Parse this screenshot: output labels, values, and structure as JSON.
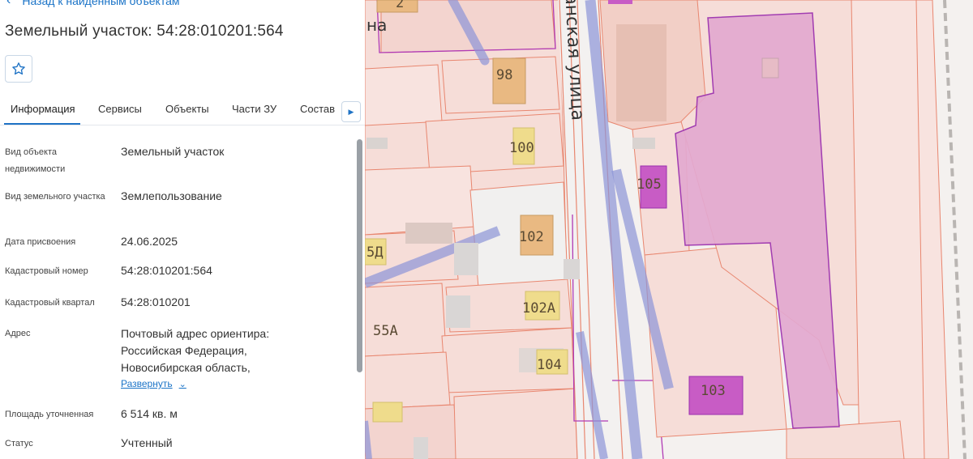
{
  "panel": {
    "back_link": "Назад к найденным объектам",
    "title": "Земельный участок: 54:28:010201:564",
    "tabs": [
      "Информация",
      "Сервисы",
      "Объекты",
      "Части ЗУ",
      "Состав"
    ],
    "active_tab": "Информация",
    "properties": [
      {
        "label": "Вид объекта недвижимости",
        "value": "Земельный участок"
      },
      {
        "label": "Вид земельного участка",
        "value": "Землепользование"
      },
      {
        "label": "Дата присвоения",
        "value": "24.06.2025"
      },
      {
        "label": "Кадастровый номер",
        "value": "54:28:010201:564"
      },
      {
        "label": "Кадастровый квартал",
        "value": "54:28:010201"
      },
      {
        "label": "Адрес",
        "value": "Почтовый адрес ориентира: Российская Федерация, Новосибирская область,"
      },
      {
        "label": "Площадь уточненная",
        "value": "6 514 кв. м"
      },
      {
        "label": "Статус",
        "value": "Учтенный"
      }
    ],
    "expand_link": "Развернуть"
  },
  "map": {
    "street_name": "Партизанская улица",
    "street_fragment_top_left": "на",
    "building_labels": [
      "2",
      "98",
      "100",
      "105",
      "102",
      "5Д",
      "55А",
      "102А",
      "104",
      "103"
    ],
    "colors": {
      "parcel_fill": "#f6ddd8",
      "boundary": "#e8866f",
      "selected_fill": "#e3a9d0",
      "selected_stroke": "#9a2fae",
      "building": "#e9b982",
      "road_highlight": "#8d95d8"
    }
  }
}
